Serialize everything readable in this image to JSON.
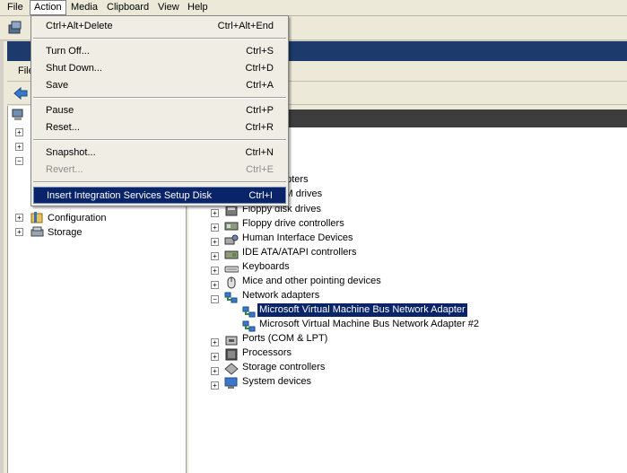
{
  "menubar": {
    "file": "File",
    "action": "Action",
    "media": "Media",
    "clipboard": "Clipboard",
    "view": "View",
    "help": "Help"
  },
  "inner_menubar": {
    "file_partial": "File"
  },
  "action_menu": {
    "items": [
      {
        "label": "Ctrl+Alt+Delete",
        "shortcut": "Ctrl+Alt+End"
      },
      {
        "label": "Turn Off...",
        "shortcut": "Ctrl+S"
      },
      {
        "label": "Shut Down...",
        "shortcut": "Ctrl+D"
      },
      {
        "label": "Save",
        "shortcut": "Ctrl+A"
      },
      {
        "label": "Pause",
        "shortcut": "Ctrl+P"
      },
      {
        "label": "Reset...",
        "shortcut": "Ctrl+R"
      },
      {
        "label": "Snapshot...",
        "shortcut": "Ctrl+N"
      },
      {
        "label": "Revert...",
        "shortcut": "Ctrl+E",
        "disabled": true
      },
      {
        "label": "Insert Integration Services Setup Disk",
        "shortcut": "Ctrl+I",
        "highlighted": true
      }
    ]
  },
  "left_tree": {
    "configuration": "Configuration",
    "storage": "Storage"
  },
  "device_tree": {
    "partial_display_adapters": "apters",
    "partial_dvd": "OM drives",
    "floppy_disk": "Floppy disk drives",
    "floppy_controllers": "Floppy drive controllers",
    "hid": "Human Interface Devices",
    "ide": "IDE ATA/ATAPI controllers",
    "keyboards": "Keyboards",
    "mice": "Mice and other pointing devices",
    "network": "Network adapters",
    "nic1": "Microsoft Virtual Machine Bus Network Adapter",
    "nic2": "Microsoft Virtual Machine Bus Network Adapter #2",
    "ports": "Ports (COM & LPT)",
    "processors": "Processors",
    "storage_controllers": "Storage controllers",
    "system_devices": "System devices"
  },
  "colors": {
    "selection": "#0a246a",
    "menu_bg": "#f0eee4",
    "chrome": "#ece9d8"
  }
}
